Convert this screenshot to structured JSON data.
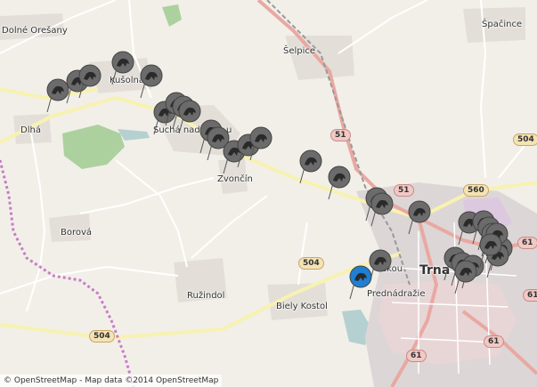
{
  "places": [
    {
      "id": "dolne-oresany",
      "label": "Dolné Orešany"
    },
    {
      "id": "kusolna",
      "label": "Kušolna"
    },
    {
      "id": "dlha",
      "label": "Dlhá"
    },
    {
      "id": "sucha-nad",
      "label": "Suchá nad"
    },
    {
      "id": "sucha-u",
      "label": "u"
    },
    {
      "id": "zvoncin",
      "label": "Zvončín"
    },
    {
      "id": "borova",
      "label": "Borová"
    },
    {
      "id": "ruzindol",
      "label": "Ružindol"
    },
    {
      "id": "biely-kostol",
      "label": "Biely Kostol"
    },
    {
      "id": "prednadrazie",
      "label": "Prednádražie"
    },
    {
      "id": "selpice",
      "label": "Šelpice"
    },
    {
      "id": "spacince",
      "label": "Špačince"
    },
    {
      "id": "trnava",
      "label": "Trna"
    },
    {
      "id": "ekou",
      "label": "ekou"
    }
  ],
  "road_shields": [
    {
      "id": "r51a",
      "label": "51"
    },
    {
      "id": "r51b",
      "label": "51"
    },
    {
      "id": "r560",
      "label": "560"
    },
    {
      "id": "r504a",
      "label": "504"
    },
    {
      "id": "r504b",
      "label": "504"
    },
    {
      "id": "r504c",
      "label": "504"
    },
    {
      "id": "r61a",
      "label": "61"
    },
    {
      "id": "r61b",
      "label": "61"
    },
    {
      "id": "r61c",
      "label": "61"
    },
    {
      "id": "r61d",
      "label": "61"
    }
  ],
  "markers": {
    "grey_count": 33,
    "blue_count": 1,
    "grey_color": "#6b6b6b",
    "blue_color": "#1e7fd4"
  },
  "attribution": "© OpenStreetMap - Map data ©2014 OpenStreetMap"
}
